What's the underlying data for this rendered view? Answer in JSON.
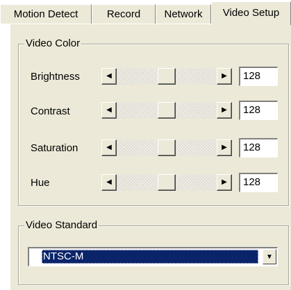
{
  "tabs": [
    {
      "label": "Motion Detect"
    },
    {
      "label": "Record"
    },
    {
      "label": "Network"
    },
    {
      "label": "Video Setup"
    }
  ],
  "active_tab": "Video Setup",
  "video_color": {
    "title": "Video Color",
    "rows": [
      {
        "label": "Brightness",
        "value": "128",
        "level": 0.5
      },
      {
        "label": "Contrast",
        "value": "128",
        "level": 0.5
      },
      {
        "label": "Saturation",
        "value": "128",
        "level": 0.5
      },
      {
        "label": "Hue",
        "value": "128",
        "level": 0.5
      }
    ],
    "left_arrow_icon": "arrow-left-icon",
    "right_arrow_icon": "arrow-right-icon"
  },
  "video_standard": {
    "title": "Video Standard",
    "selected": "NTSC-M",
    "dropdown_icon": "chevron-down-icon"
  },
  "colors": {
    "dialog_bg": "#ece9d8",
    "selection_bg": "#0a246a",
    "selection_fg": "#ffffff"
  }
}
